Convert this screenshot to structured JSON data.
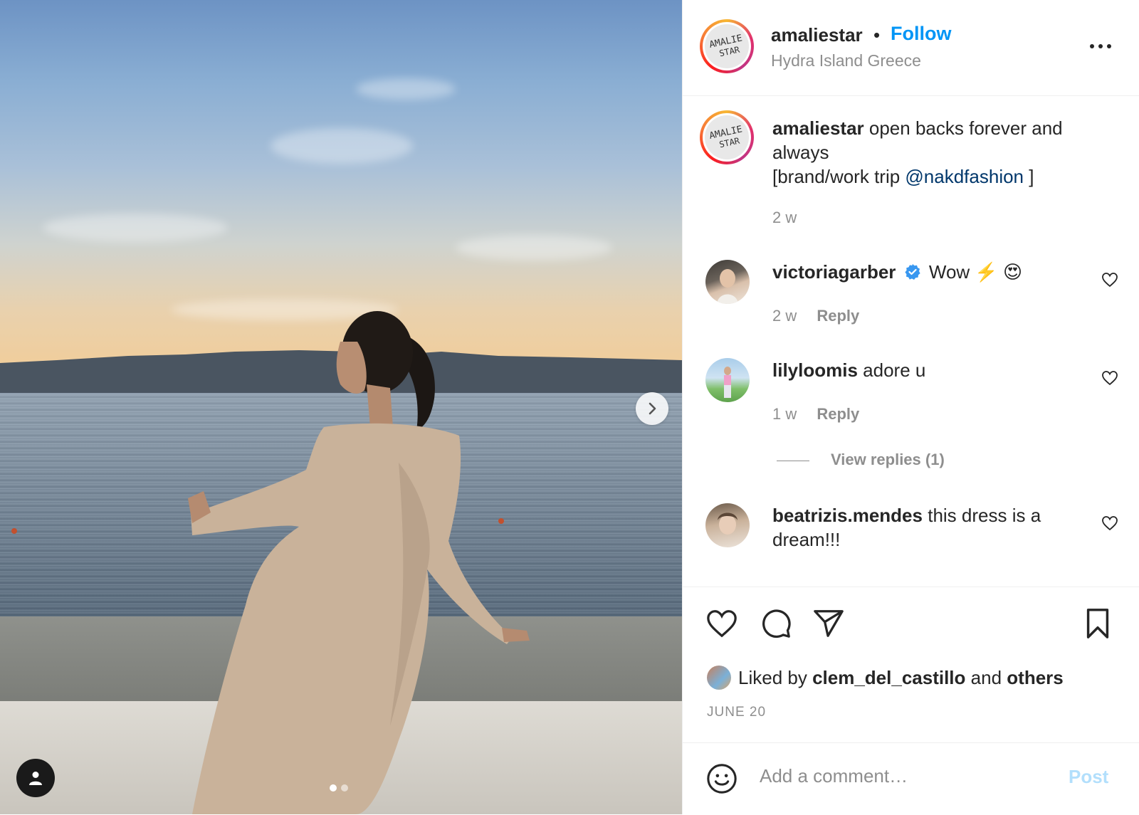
{
  "post": {
    "username": "amaliestar",
    "separator": "•",
    "follow_label": "Follow",
    "location": "Hydra Island Greece",
    "avatar_text": "AMALIE STAR",
    "slide_count": 2,
    "active_slide": 1
  },
  "caption": {
    "username": "amaliestar",
    "text_line1": "open backs forever and always",
    "text_line2_prefix": "[brand/work trip ",
    "mention": "@nakdfashion",
    "text_line2_suffix": " ]",
    "time": "2 w"
  },
  "comments": [
    {
      "username": "victoriagarber",
      "verified": true,
      "text": "Wow ⚡️ 😍",
      "time": "2 w",
      "reply_label": "Reply"
    },
    {
      "username": "lilyloomis",
      "verified": false,
      "text": "adore u",
      "time": "1 w",
      "reply_label": "Reply",
      "view_replies": "View replies (1)"
    },
    {
      "username": "beatrizis.mendes",
      "verified": false,
      "text": "this dress is a dream!!!"
    }
  ],
  "likes": {
    "prefix": "Liked by ",
    "user": "clem_del_castillo",
    "middle": " and ",
    "others": "others"
  },
  "date": "JUNE 20",
  "comment_box": {
    "placeholder": "Add a comment…",
    "post_label": "Post"
  },
  "colors": {
    "follow": "#0095f6",
    "mention": "#00376b",
    "muted": "#8e8e8e",
    "post_disabled": "#b2dffc"
  }
}
